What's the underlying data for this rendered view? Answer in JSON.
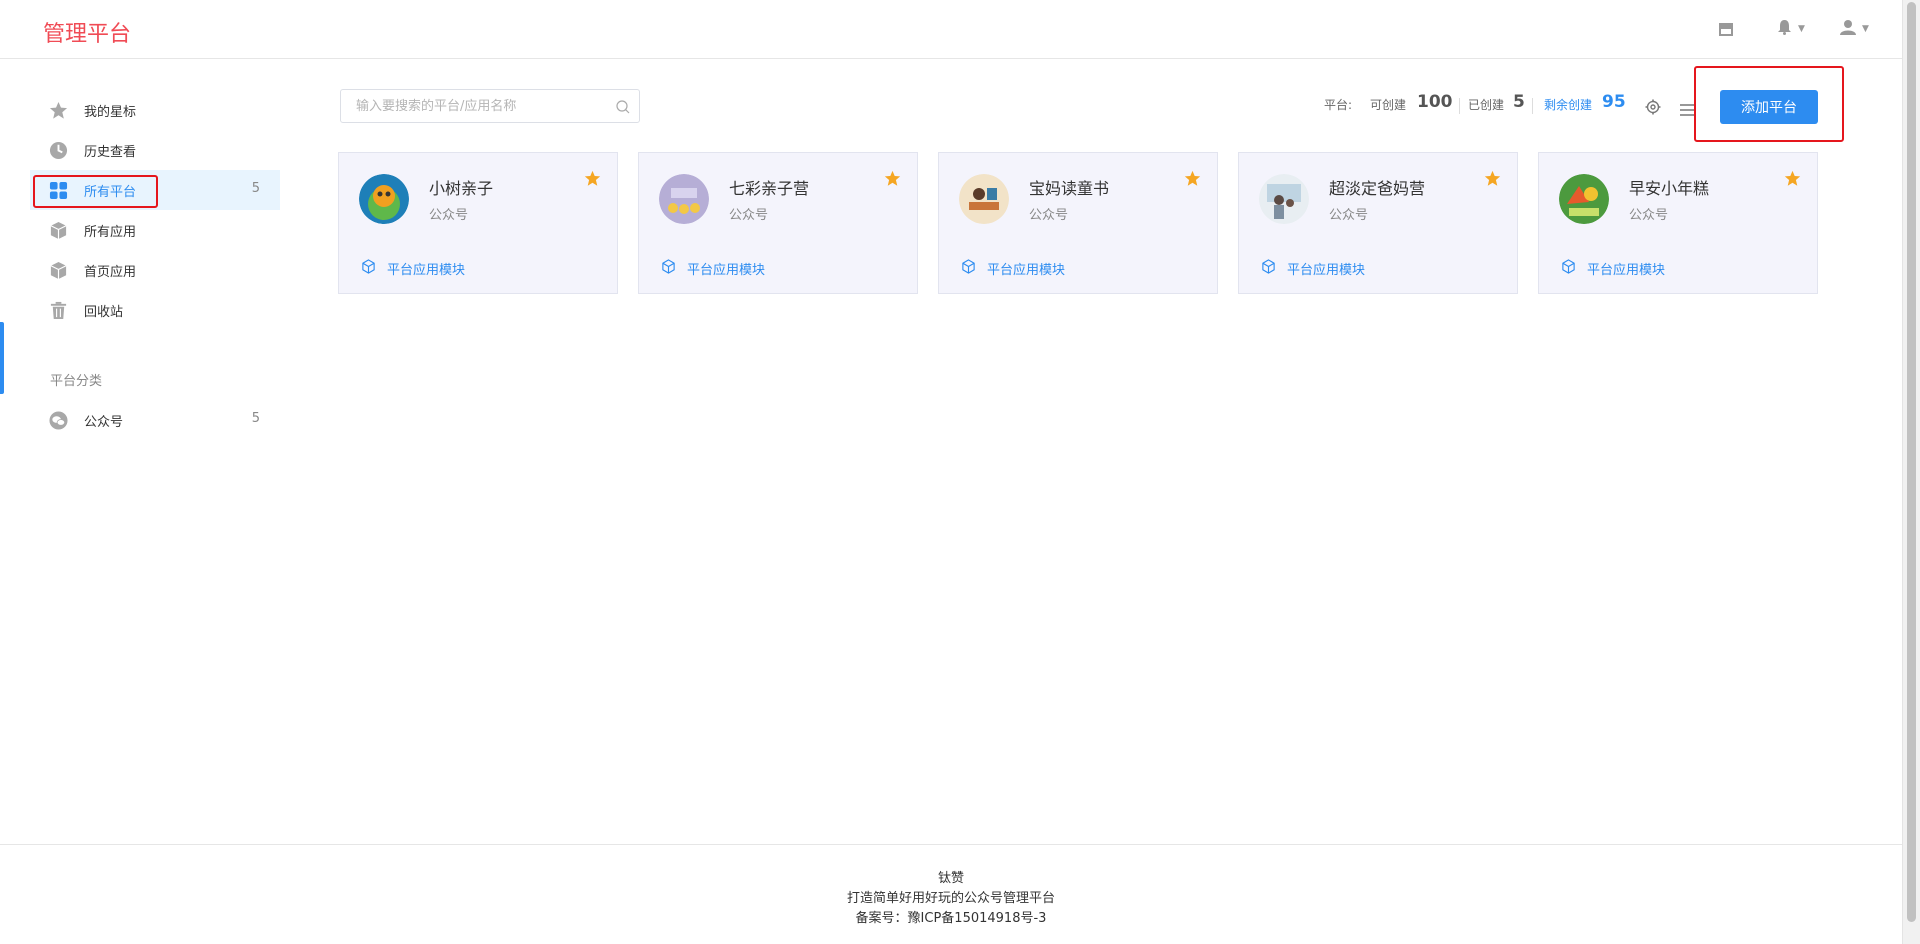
{
  "app": {
    "title": "管理平台"
  },
  "header": {
    "icons": [
      "store-icon",
      "bell-icon",
      "user-icon"
    ]
  },
  "sidebar": {
    "items": [
      {
        "label": "我的星标",
        "icon": "star-icon"
      },
      {
        "label": "历史查看",
        "icon": "clock-icon"
      },
      {
        "label": "所有平台",
        "icon": "grid-icon",
        "count": "5",
        "active": true
      },
      {
        "label": "所有应用",
        "icon": "cube-icon"
      },
      {
        "label": "首页应用",
        "icon": "cube-icon"
      },
      {
        "label": "回收站",
        "icon": "trash-icon"
      }
    ],
    "group_title": "平台分类",
    "groups": [
      {
        "label": "公众号",
        "icon": "wechat-icon",
        "count": "5"
      }
    ]
  },
  "search": {
    "placeholder": "输入要搜索的平台/应用名称",
    "value": ""
  },
  "stats": {
    "platform_label": "平台:",
    "can_create_label": "可创建",
    "can_create_value": "100",
    "created_label": "已创建",
    "created_value": "5",
    "remaining_label": "剩余创建",
    "remaining_value": "95"
  },
  "toolbar": {
    "add_label": "添加平台"
  },
  "cards": [
    {
      "name": "小树亲子",
      "type": "公众号",
      "module_label": "平台应用模块"
    },
    {
      "name": "七彩亲子营",
      "type": "公众号",
      "module_label": "平台应用模块"
    },
    {
      "name": "宝妈读童书",
      "type": "公众号",
      "module_label": "平台应用模块"
    },
    {
      "name": "超淡定爸妈营",
      "type": "公众号",
      "module_label": "平台应用模块"
    },
    {
      "name": "早安小年糕",
      "type": "公众号",
      "module_label": "平台应用模块"
    }
  ],
  "footer": {
    "line1": "钛赞",
    "line2": "打造简单好用好玩的公众号管理平台",
    "line3": "备案号：豫ICP备15014918号-3"
  },
  "colors": {
    "brand": "#f04b55",
    "accent": "#2d8cf0",
    "star": "#f5a623",
    "highlight": "#e5161d"
  }
}
